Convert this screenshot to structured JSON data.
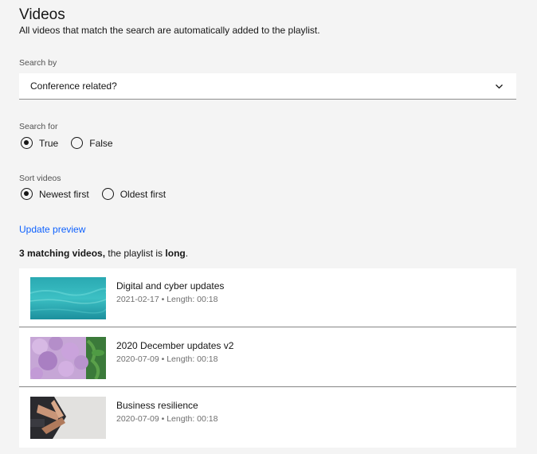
{
  "header": {
    "title": "Videos",
    "subtitle": "All videos that match the search are automatically added to the playlist."
  },
  "search_by": {
    "label": "Search by",
    "selected": "Conference related?",
    "icon": "chevron-down-icon"
  },
  "search_for": {
    "label": "Search for",
    "options": [
      {
        "label": "True",
        "checked": true
      },
      {
        "label": "False",
        "checked": false
      }
    ]
  },
  "sort_videos": {
    "label": "Sort videos",
    "options": [
      {
        "label": "Newest first",
        "checked": true
      },
      {
        "label": "Oldest first",
        "checked": false
      }
    ]
  },
  "update_link": "Update preview",
  "summary": {
    "count_text": "3 matching videos,",
    "middle_text": " the playlist is ",
    "length_word": "long",
    "end_text": "."
  },
  "videos": [
    {
      "title": "Digital and cyber updates",
      "meta": "2021-02-17 • Length: 00:18"
    },
    {
      "title": "2020 December updates v2",
      "meta": "2020-07-09 • Length: 00:18"
    },
    {
      "title": "Business resilience",
      "meta": "2020-07-09 • Length: 00:18"
    }
  ],
  "colors": {
    "background": "#f4f4f4",
    "link": "#0f62fe",
    "text": "#161616"
  }
}
